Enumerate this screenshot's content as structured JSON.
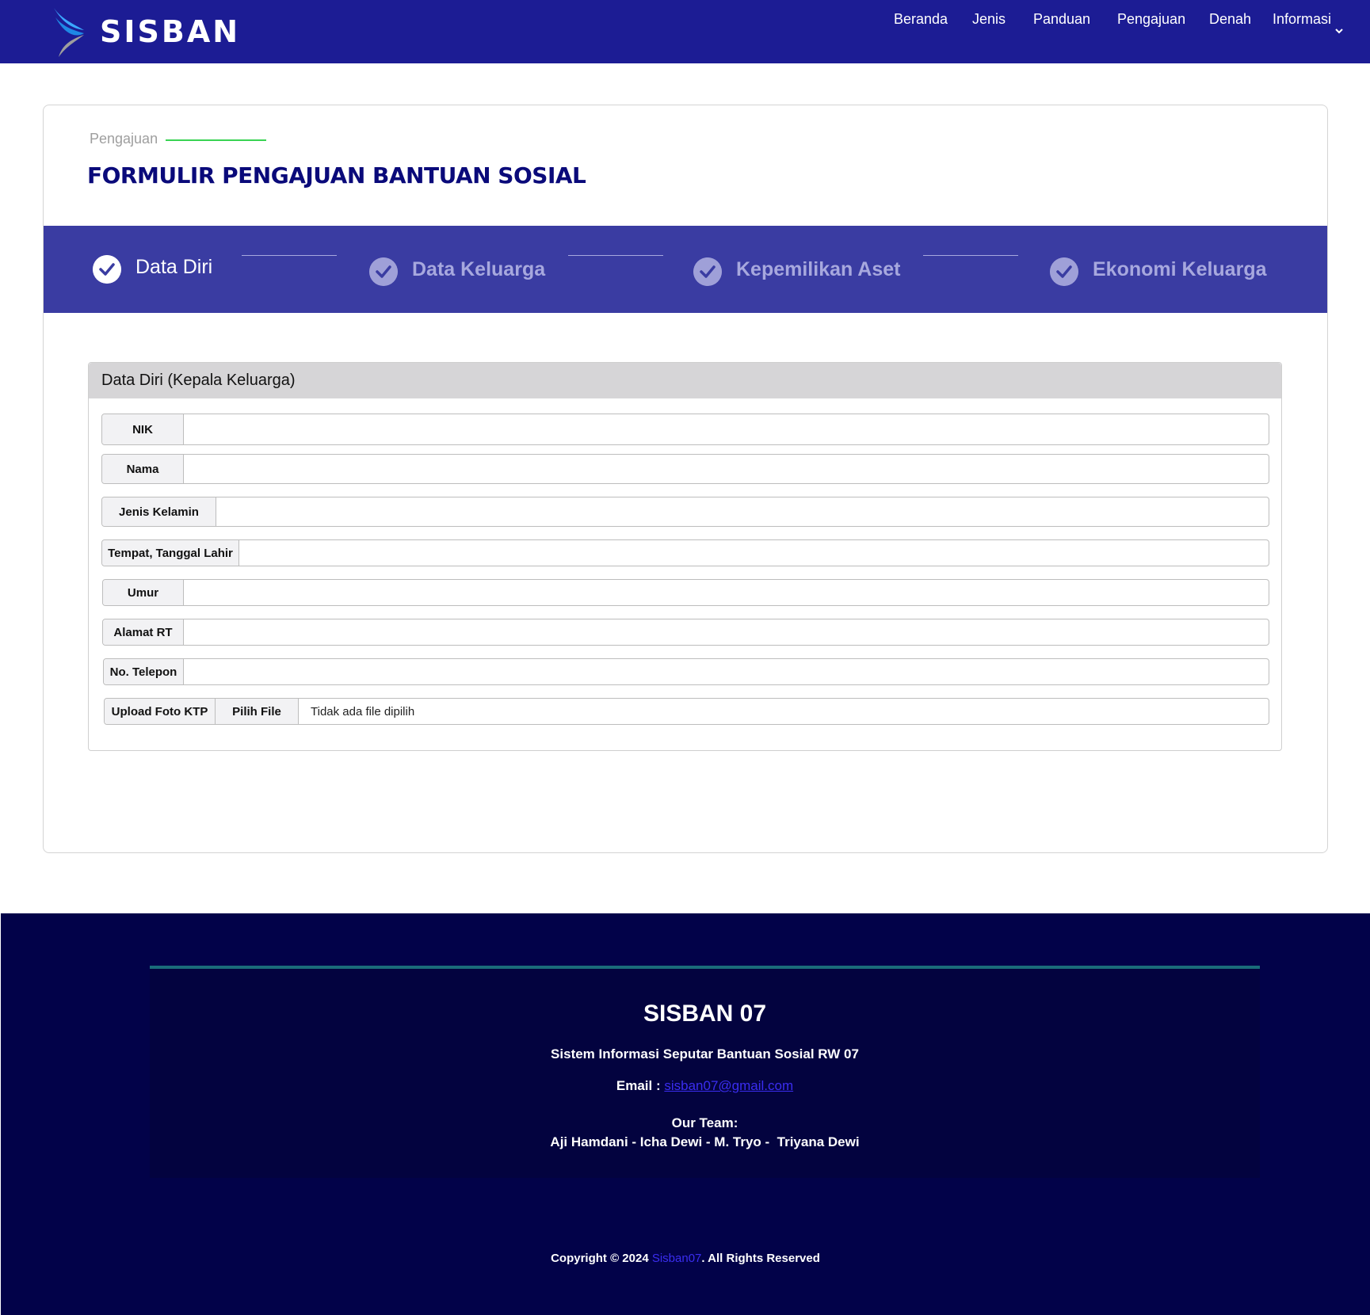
{
  "navbar": {
    "brand": "SISBAN",
    "items": [
      "Beranda",
      "Jenis",
      "Panduan",
      "Pengajuan",
      "Denah",
      "Informasi"
    ]
  },
  "page": {
    "eyebrow": "Pengajuan",
    "title": "FORMULIR PENGAJUAN BANTUAN SOSIAL"
  },
  "stepper": {
    "steps": [
      {
        "label": "Data Diri",
        "state": "active"
      },
      {
        "label": "Data Keluarga",
        "state": "inactive"
      },
      {
        "label": "Kepemilikan Aset",
        "state": "inactive"
      },
      {
        "label": "Ekonomi Keluarga",
        "state": "inactive"
      }
    ]
  },
  "form": {
    "section_title": "Data Diri (Kepala Keluarga)",
    "fields": {
      "nik": {
        "label": "NIK",
        "value": ""
      },
      "nama": {
        "label": "Nama",
        "value": ""
      },
      "jenis_kelamin": {
        "label": "Jenis Kelamin",
        "value": ""
      },
      "ttl": {
        "label": "Tempat, Tanggal Lahir",
        "value": ""
      },
      "umur": {
        "label": "Umur",
        "value": ""
      },
      "alamat": {
        "label": "Alamat RT",
        "value": ""
      },
      "telepon": {
        "label": "No. Telepon",
        "value": ""
      }
    },
    "upload": {
      "label": "Upload Foto KTP",
      "button": "Pilih File",
      "status": "Tidak ada file dipilih"
    }
  },
  "footer": {
    "title": "SISBAN 07",
    "subtitle": "Sistem Informasi Seputar Bantuan Sosial RW 07",
    "email_label": "Email :",
    "email": "sisban07@gmail.com",
    "team_label": "Our Team:",
    "team": "Aji Hamdani - Icha Dewi - M. Tryo -  Triyana Dewi",
    "copyright_prefix": "Copyright © 2024",
    "copyright_brand": "Sisban07",
    "copyright_suffix": ". All Rights Reserved"
  },
  "colors": {
    "navbar": "#1c1c94",
    "stepper": "#3a3ca2",
    "title": "#0a0a7a",
    "footer": "#020249",
    "accent_line": "#39d353",
    "link": "#3a2df0"
  }
}
